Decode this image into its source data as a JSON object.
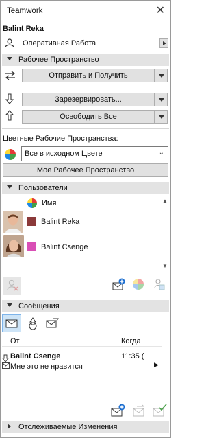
{
  "window": {
    "title": "Teamwork",
    "close_glyph": "✕"
  },
  "user": {
    "name": "Balint Reka",
    "mode_label": "Оперативная Работа"
  },
  "workspace_section": {
    "title": "Рабочее Пространство"
  },
  "send_receive": {
    "label": "Отправить и Получить"
  },
  "reserve": {
    "label": "Зарезервировать..."
  },
  "release": {
    "label": "Освободить Все"
  },
  "color_workspaces": {
    "label": "Цветные Рабочие Пространства:",
    "selected": "Все в исходном Цвете",
    "my_workspace_button": "Мое Рабочее Пространство"
  },
  "users_section": {
    "title": "Пользователи",
    "column_name": "Имя",
    "users": [
      {
        "name": "Balint Reka",
        "color": "#8b3a3a"
      },
      {
        "name": "Balint Csenge",
        "color": "#d94fb5"
      }
    ]
  },
  "messages_section": {
    "title": "Сообщения",
    "col_from": "От",
    "col_when": "Когда",
    "messages": [
      {
        "from": "Balint Csenge",
        "time": "11:35 (",
        "text": "Мне это не нравится"
      }
    ]
  },
  "tracked_changes": {
    "title": "Отслеживаемые Изменения"
  },
  "colors": {
    "section_bg": "#e3e3e3",
    "button_bg": "#e1e1e1",
    "active_tab": "#cde4f7",
    "accent_blue": "#1e6fd0",
    "accent_green": "#4aa34a"
  }
}
